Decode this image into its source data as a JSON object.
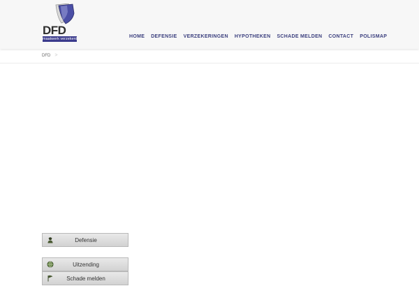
{
  "logo": {
    "name": "DFD",
    "tagline": "maatwerk verzekerd"
  },
  "nav": {
    "items": [
      "HOME",
      "DEFENSIE",
      "VERZEKERINGEN",
      "HYPOTHEKEN",
      "SCHADE MELDEN",
      "CONTACT",
      "POLISMAP"
    ]
  },
  "breadcrumb": {
    "root": "DFD",
    "separator": ">"
  },
  "sidebar": {
    "buttons": [
      {
        "label": "Defensie",
        "icon": "soldier-icon"
      },
      {
        "label": "Uitzending",
        "icon": "globe-icon"
      },
      {
        "label": "Schade melden",
        "icon": "flag-icon"
      }
    ]
  },
  "colors": {
    "nav_text": "#3b3f7e",
    "logo_blue": "#3a3a8c",
    "header_bg": "#f7f7f7"
  }
}
